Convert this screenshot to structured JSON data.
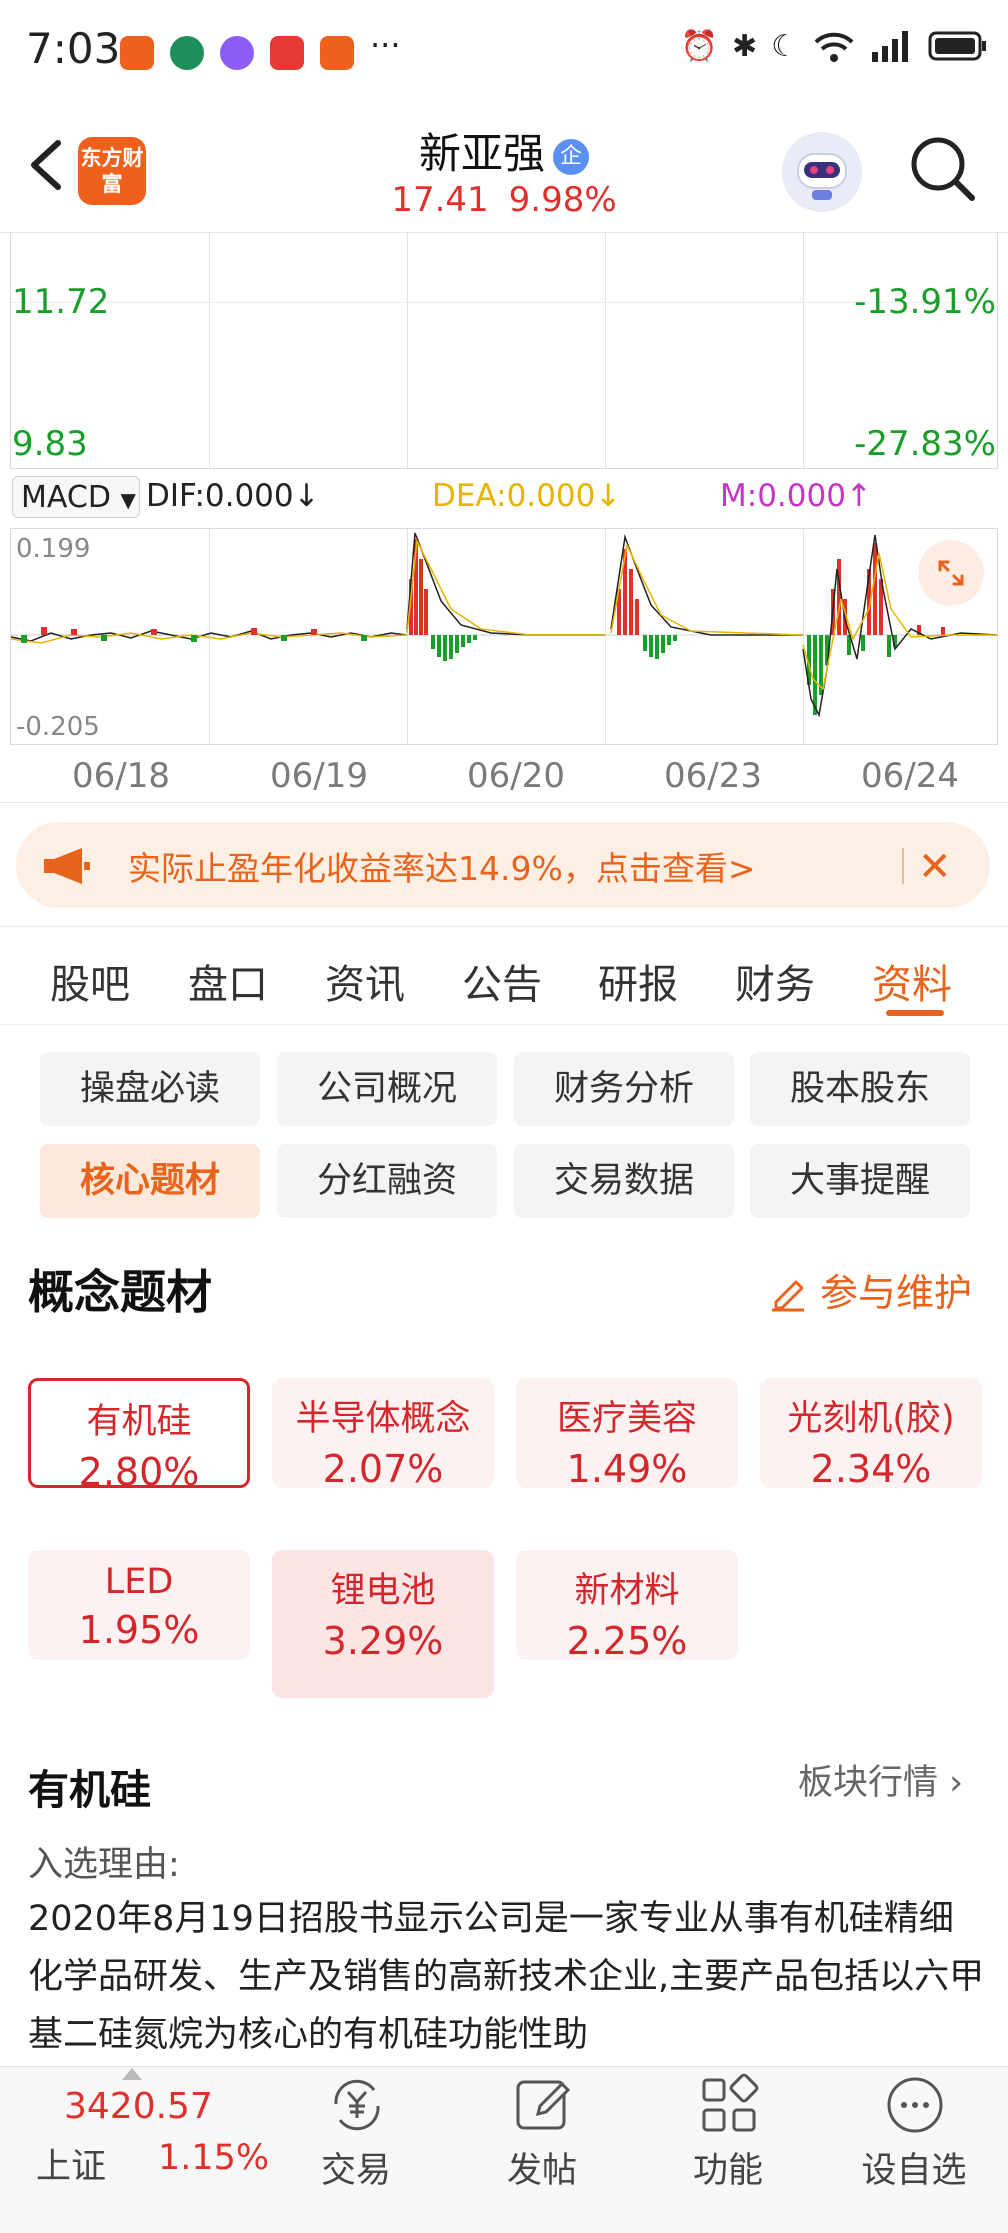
{
  "status_bar": {
    "time": "7:03",
    "more": "···"
  },
  "header": {
    "logo_text": "东方财富",
    "stock_name": "新亚强",
    "badge": "企",
    "price": "17.41",
    "change_pct": "9.98%"
  },
  "price_chart": {
    "left_high": "11.72",
    "left_low": "9.83",
    "right_high": "-13.91%",
    "right_low": "-27.83%"
  },
  "macd": {
    "selector": "MACD",
    "dif": "DIF:0.000↓",
    "dea": "DEA:0.000↓",
    "m": "M:0.000↑",
    "top_value": "0.199",
    "bottom_value": "-0.205"
  },
  "dates": [
    "06/18",
    "06/19",
    "06/20",
    "06/23",
    "06/24"
  ],
  "promo": {
    "text": "实际止盈年化收益率达14.9%，点击查看>",
    "close": "✕"
  },
  "tabs": [
    "股吧",
    "盘口",
    "资讯",
    "公告",
    "研报",
    "财务",
    "资料"
  ],
  "active_tab": "资料",
  "chips": [
    "操盘必读",
    "公司概况",
    "财务分析",
    "股本股东",
    "核心题材",
    "分红融资",
    "交易数据",
    "大事提醒"
  ],
  "active_chip": "核心题材",
  "concepts": {
    "title": "概念题材",
    "edit_label": "参与维护",
    "items": [
      {
        "name": "有机硅",
        "pct": "2.80%"
      },
      {
        "name": "半导体概念",
        "pct": "2.07%"
      },
      {
        "name": "医疗美容",
        "pct": "1.49%"
      },
      {
        "name": "光刻机(胶)",
        "pct": "2.34%"
      },
      {
        "name": "LED",
        "pct": "1.95%"
      },
      {
        "name": "锂电池",
        "pct": "3.29%"
      },
      {
        "name": "新材料",
        "pct": "2.25%"
      }
    ]
  },
  "detail": {
    "title": "有机硅",
    "link": "板块行情 ›",
    "reason_label": "入选理由:",
    "reason": "2020年8月19日招股书显示公司是一家专业从事有机硅精细化学品研发、生产及销售的高新技术企业,主要产品包括以六甲基二硅氮烷为核心的有机硅功能性助"
  },
  "bottom_nav": {
    "index_value": "3420.57",
    "index_name": "上证",
    "index_pct": "1.15%",
    "items": [
      "交易",
      "发帖",
      "功能",
      "设自选"
    ]
  },
  "colors": {
    "accent": "#e8631c",
    "up": "#e0302c",
    "down": "#1a9e2a",
    "dea": "#e8b400",
    "m": "#c633c6"
  }
}
